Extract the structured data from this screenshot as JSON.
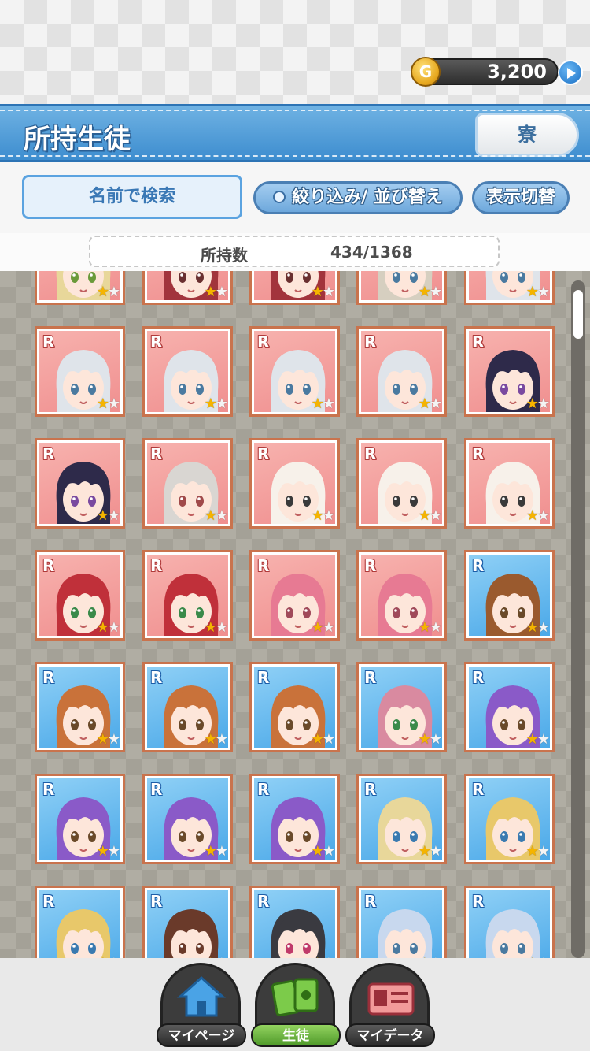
{
  "header": {
    "coin_symbol": "G",
    "coin_value": "3,200",
    "title": "所持生徒",
    "dorm_button": "寮"
  },
  "toolbar": {
    "search_name": "名前で検索",
    "filter_sort": "絞り込み/ 並び替え",
    "display_toggle": "表示切替"
  },
  "count": {
    "label": "所持数",
    "value": "434/1368"
  },
  "cards": {
    "rarity_label": "R",
    "rows": [
      [
        {
          "bg": "rare",
          "rating": 1,
          "hair": "#e8d79a",
          "eye": "#6a9a3a"
        },
        {
          "bg": "rare",
          "rating": 1,
          "hair": "#a2343c",
          "eye": "#6a3030"
        },
        {
          "bg": "rare",
          "rating": 1,
          "hair": "#a2343c",
          "eye": "#6a3030"
        },
        {
          "bg": "rare",
          "rating": 1,
          "hair": "#d6cfc0",
          "eye": "#4a7aa0"
        },
        {
          "bg": "rare",
          "rating": 1,
          "hair": "#dfe4ea",
          "eye": "#4a7aa0"
        }
      ],
      [
        {
          "bg": "rare",
          "rating": 1,
          "hair": "#dfe4ea",
          "eye": "#4a7aa0"
        },
        {
          "bg": "rare",
          "rating": 1,
          "hair": "#dfe4ea",
          "eye": "#4a7aa0"
        },
        {
          "bg": "rare",
          "rating": 1,
          "hair": "#dfe4ea",
          "eye": "#4a7aa0"
        },
        {
          "bg": "rare",
          "rating": 1,
          "hair": "#dfe4ea",
          "eye": "#4a7aa0"
        },
        {
          "bg": "rare",
          "rating": 1,
          "hair": "#2e2a4a",
          "eye": "#7a4aa0"
        }
      ],
      [
        {
          "bg": "rare",
          "rating": 1,
          "hair": "#2e2a4a",
          "eye": "#7a4aa0"
        },
        {
          "bg": "rare",
          "rating": 1,
          "hair": "#d9d6d2",
          "eye": "#a04a4a"
        },
        {
          "bg": "rare",
          "rating": 1,
          "hair": "#f7f1ea",
          "eye": "#3a3a3a"
        },
        {
          "bg": "rare",
          "rating": 1,
          "hair": "#f7f1ea",
          "eye": "#3a3a3a"
        },
        {
          "bg": "rare",
          "rating": 1,
          "hair": "#f7f1ea",
          "eye": "#3a3a3a"
        }
      ],
      [
        {
          "bg": "rare",
          "rating": 1,
          "hair": "#c0303a",
          "eye": "#3a8a4a"
        },
        {
          "bg": "rare",
          "rating": 1,
          "hair": "#c0303a",
          "eye": "#3a8a4a"
        },
        {
          "bg": "rare",
          "rating": 1,
          "hair": "#e77a93",
          "eye": "#a04a5a"
        },
        {
          "bg": "rare",
          "rating": 1,
          "hair": "#e77a93",
          "eye": "#a04a5a"
        },
        {
          "bg": "blue",
          "rating": 1,
          "hair": "#9a5a2e",
          "eye": "#6a4a2a"
        }
      ],
      [
        {
          "bg": "blue",
          "rating": 1,
          "hair": "#c9723a",
          "eye": "#6a4a2a"
        },
        {
          "bg": "blue",
          "rating": 1,
          "hair": "#c9723a",
          "eye": "#6a4a2a"
        },
        {
          "bg": "blue",
          "rating": 1,
          "hair": "#c9723a",
          "eye": "#6a4a2a"
        },
        {
          "bg": "blue",
          "rating": 1,
          "hair": "#d98aa0",
          "eye": "#3a8a4a"
        },
        {
          "bg": "blue",
          "rating": 1,
          "hair": "#8a5ac8",
          "eye": "#6a4a2a"
        }
      ],
      [
        {
          "bg": "blue",
          "rating": 1,
          "hair": "#8a5ac8",
          "eye": "#6a4a2a"
        },
        {
          "bg": "blue",
          "rating": 1,
          "hair": "#8a5ac8",
          "eye": "#6a4a2a"
        },
        {
          "bg": "blue",
          "rating": 1,
          "hair": "#8a5ac8",
          "eye": "#6a4a2a"
        },
        {
          "bg": "blue",
          "rating": 1,
          "hair": "#e8d79a",
          "eye": "#3a7ab0"
        },
        {
          "bg": "blue",
          "rating": 1,
          "hair": "#e8c86a",
          "eye": "#3a7ab0"
        }
      ],
      [
        {
          "bg": "blue",
          "rating": 1,
          "hair": "#e8c86a",
          "eye": "#3a7ab0"
        },
        {
          "bg": "blue",
          "rating": 1,
          "hair": "#6a3a2a",
          "eye": "#6a3a2a"
        },
        {
          "bg": "blue",
          "rating": 1,
          "hair": "#3a3a40",
          "eye": "#c03a6a"
        },
        {
          "bg": "blue",
          "rating": 1,
          "hair": "#c8d8ee",
          "eye": "#4a7aa0"
        },
        {
          "bg": "blue",
          "rating": 1,
          "hair": "#c8d8ee",
          "eye": "#4a7aa0"
        }
      ]
    ]
  },
  "bottom_nav": {
    "mypage": "マイページ",
    "students": "生徒",
    "mydata": "マイデータ"
  },
  "colors": {
    "header_blue": "#3d8dcf",
    "card_border": "#c9734d",
    "star_on": "#f5b400",
    "students_tab": "#4f9a2a"
  }
}
